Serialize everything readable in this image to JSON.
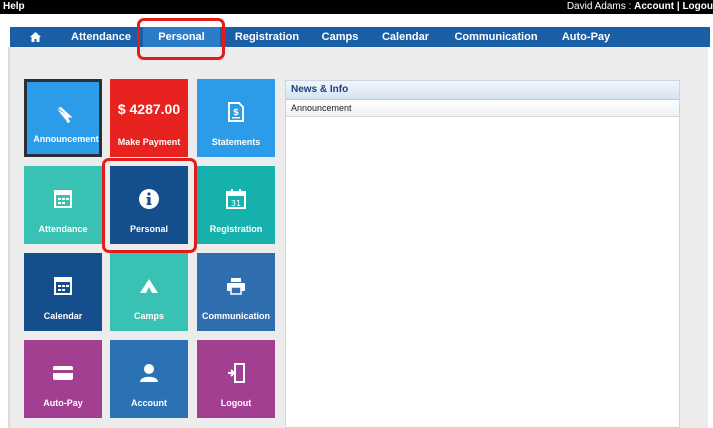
{
  "topbar": {
    "help": "Help",
    "user_name": "David Adams",
    "separator": " : ",
    "account": "Account",
    "divider": " | ",
    "logout": "Logou"
  },
  "nav": {
    "home_icon": "home-icon",
    "items": [
      {
        "label": "Attendance"
      },
      {
        "label": "Personal",
        "active": true
      },
      {
        "label": "Registration"
      },
      {
        "label": "Camps"
      },
      {
        "label": "Calendar"
      },
      {
        "label": "Communication"
      },
      {
        "label": "Auto-Pay"
      }
    ]
  },
  "tiles": [
    {
      "label": "Announcement",
      "icon": "megaphone-icon",
      "color": "#2c9be8"
    },
    {
      "label": "Make Payment",
      "amount": "$ 4287.00",
      "color": "#e8231f"
    },
    {
      "label": "Statements",
      "icon": "document-dollar-icon",
      "color": "#2c9be8"
    },
    {
      "label": "Attendance",
      "icon": "grid-calendar-icon",
      "color": "#39c2b3"
    },
    {
      "label": "Personal",
      "icon": "info-icon",
      "color": "#144e8c"
    },
    {
      "label": "Registration",
      "icon": "calendar-31-icon",
      "color": "#17b1ad"
    },
    {
      "label": "Calendar",
      "icon": "calendar-icon",
      "color": "#144e8c"
    },
    {
      "label": "Camps",
      "icon": "tent-icon",
      "color": "#39c2b3"
    },
    {
      "label": "Communication",
      "icon": "printer-icon",
      "color": "#2f6fb0"
    },
    {
      "label": "Auto-Pay",
      "icon": "credit-card-icon",
      "color": "#a23f91"
    },
    {
      "label": "Account",
      "icon": "user-icon",
      "color": "#2a72b4"
    },
    {
      "label": "Logout",
      "icon": "exit-door-icon",
      "color": "#a23f91"
    }
  ],
  "news": {
    "title": "News & Info",
    "rows": [
      "Announcement"
    ]
  },
  "colors": {
    "nav_bar": "#1a5fa6",
    "highlight": "#e21b1b",
    "news_title": "#1e3f76"
  }
}
